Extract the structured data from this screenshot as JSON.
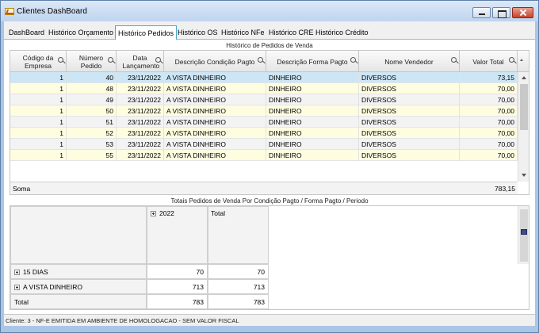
{
  "window": {
    "title": "Clientes DashBoard"
  },
  "tabs": [
    {
      "label": "DashBoard"
    },
    {
      "label": "Histórico Orçamento"
    },
    {
      "label": "Histórico Pedidos"
    },
    {
      "label": "Histórico OS"
    },
    {
      "label": "Histórico NFe"
    },
    {
      "label": "Histórico CRE"
    },
    {
      "label": "Histórico Crédito"
    }
  ],
  "orders": {
    "section_title": "Histórico de Pedidos de Venda",
    "columns": {
      "empresa": "Código da Empresa",
      "pedido": "Número Pedido",
      "data": "Data Lançamento",
      "condicao": "Descrição Condição Pagto",
      "forma": "Descrição Forma Pagto",
      "vendedor": "Nome Vendedor",
      "valor": "Valor Total"
    },
    "rows": [
      {
        "empresa": "1",
        "pedido": "40",
        "data": "23/11/2022",
        "condicao": "A VISTA DINHEIRO",
        "forma": "DINHEIRO",
        "vendedor": "DIVERSOS",
        "valor": "73,15"
      },
      {
        "empresa": "1",
        "pedido": "48",
        "data": "23/11/2022",
        "condicao": "A VISTA DINHEIRO",
        "forma": "DINHEIRO",
        "vendedor": "DIVERSOS",
        "valor": "70,00"
      },
      {
        "empresa": "1",
        "pedido": "49",
        "data": "23/11/2022",
        "condicao": "A VISTA DINHEIRO",
        "forma": "DINHEIRO",
        "vendedor": "DIVERSOS",
        "valor": "70,00"
      },
      {
        "empresa": "1",
        "pedido": "50",
        "data": "23/11/2022",
        "condicao": "A VISTA DINHEIRO",
        "forma": "DINHEIRO",
        "vendedor": "DIVERSOS",
        "valor": "70,00"
      },
      {
        "empresa": "1",
        "pedido": "51",
        "data": "23/11/2022",
        "condicao": "A VISTA DINHEIRO",
        "forma": "DINHEIRO",
        "vendedor": "DIVERSOS",
        "valor": "70,00"
      },
      {
        "empresa": "1",
        "pedido": "52",
        "data": "23/11/2022",
        "condicao": "A VISTA DINHEIRO",
        "forma": "DINHEIRO",
        "vendedor": "DIVERSOS",
        "valor": "70,00"
      },
      {
        "empresa": "1",
        "pedido": "53",
        "data": "23/11/2022",
        "condicao": "A VISTA DINHEIRO",
        "forma": "DINHEIRO",
        "vendedor": "DIVERSOS",
        "valor": "70,00"
      },
      {
        "empresa": "1",
        "pedido": "55",
        "data": "23/11/2022",
        "condicao": "A VISTA DINHEIRO",
        "forma": "DINHEIRO",
        "vendedor": "DIVERSOS",
        "valor": "70,00"
      }
    ],
    "summary": {
      "label": "Soma",
      "total": "783,15"
    }
  },
  "pivot": {
    "section_title": "Totais Pedidos de Venda Por Condição Pagto / Forma Pagto / Periodo",
    "col_headers": {
      "year": "2022",
      "total": "Total"
    },
    "rows": [
      {
        "label": "15 DIAS",
        "year_value": "70",
        "total": "70"
      },
      {
        "label": "A VISTA DINHEIRO",
        "year_value": "713",
        "total": "713"
      }
    ],
    "total_row": {
      "label": "Total",
      "year_value": "783",
      "total": "783"
    }
  },
  "status": {
    "text": "Cliente: 3 - NF-E EMITIDA EM AMBIENTE DE HOMOLOGACAO - SEM VALOR FISCAL"
  }
}
